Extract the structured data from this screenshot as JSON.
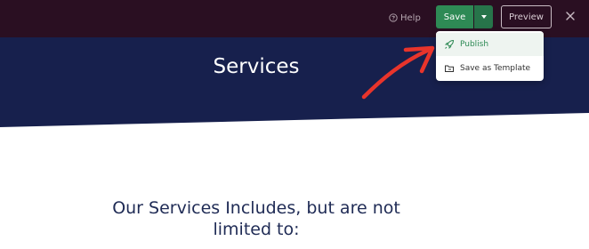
{
  "toolbar": {
    "help_label": "Help",
    "help_icon": "question-circle-icon",
    "save_label": "Save",
    "save_toggle_icon": "caret-down-icon",
    "preview_label": "Preview",
    "close_icon": "close-icon"
  },
  "save_menu": {
    "items": [
      {
        "label": "Publish",
        "icon": "rocket-icon"
      },
      {
        "label": "Save as Template",
        "icon": "folder-icon"
      }
    ]
  },
  "hero": {
    "title": "Services"
  },
  "content": {
    "heading_line1": "Our Services Includes, but are not",
    "heading_line2": "limited to:"
  },
  "colors": {
    "topbar": "#2a0f22",
    "hero": "#17204d",
    "save": "#2e8a55",
    "save_toggle": "#27744a",
    "annotation_arrow": "#e8342b",
    "heading": "#1f2b55"
  }
}
